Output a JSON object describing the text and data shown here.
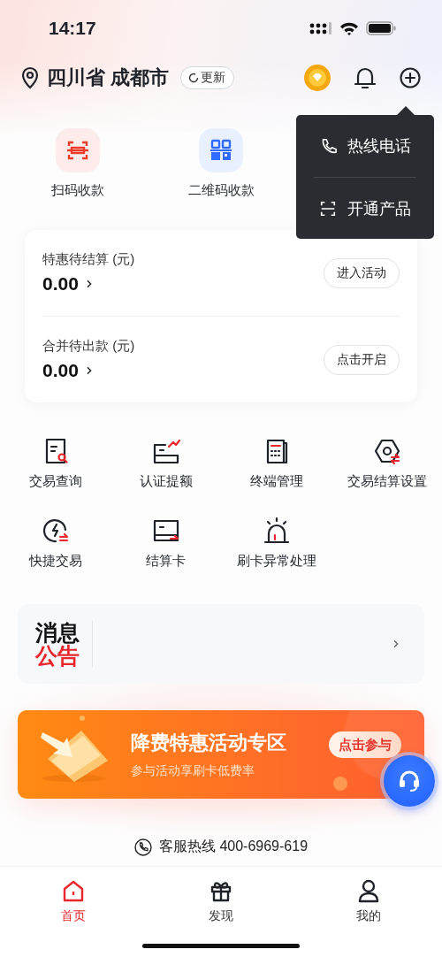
{
  "status_bar": {
    "time": "14:17"
  },
  "header": {
    "location": "四川省 成都市",
    "refresh_button": "更新"
  },
  "quick_actions": [
    {
      "label": "扫码收款",
      "kind": "scan"
    },
    {
      "label": "二维码收款",
      "kind": "qr"
    }
  ],
  "balance_card": {
    "rows": [
      {
        "label": "特惠待结算 (元)",
        "amount": "0.00",
        "button": "进入活动"
      },
      {
        "label": "合并待出款 (元)",
        "amount": "0.00",
        "button": "点击开启"
      }
    ]
  },
  "features": [
    {
      "label": "交易查询",
      "kind": "query"
    },
    {
      "label": "认证提额",
      "kind": "limit"
    },
    {
      "label": "终端管理",
      "kind": "terminal"
    },
    {
      "label": "交易结算设置",
      "kind": "settings"
    },
    {
      "label": "快捷交易",
      "kind": "quick"
    },
    {
      "label": "结算卡",
      "kind": "card"
    },
    {
      "label": "刷卡异常处理",
      "kind": "alarm"
    }
  ],
  "notice": {
    "title_top": "消息",
    "title_bottom": "公告"
  },
  "banner": {
    "title": "降费特惠活动专区",
    "subtitle": "参与活动享刷卡低费率",
    "button": "点击参与"
  },
  "hotline": "客服热线 400-6969-619",
  "tabs": [
    {
      "label": "首页",
      "kind": "home",
      "selected": true
    },
    {
      "label": "发现",
      "kind": "gift",
      "selected": false
    },
    {
      "label": "我的",
      "kind": "user",
      "selected": false
    }
  ],
  "popup_menu": [
    {
      "label": "热线电话",
      "kind": "phone"
    },
    {
      "label": "开通产品",
      "kind": "scan"
    }
  ]
}
